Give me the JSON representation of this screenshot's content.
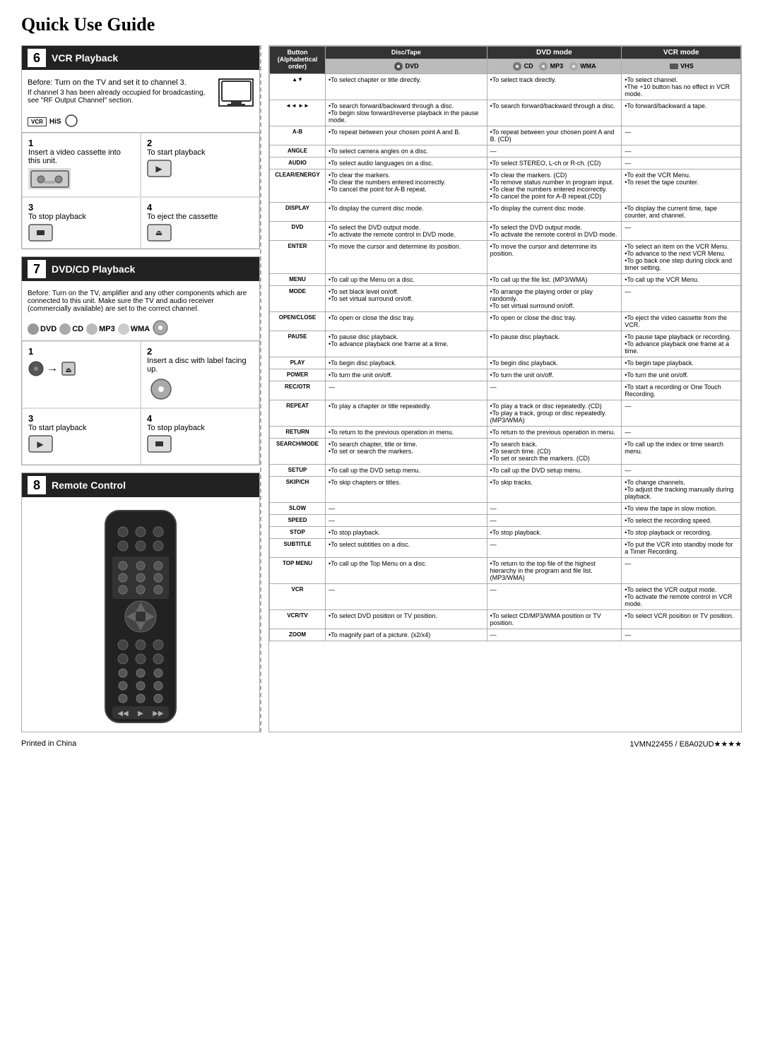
{
  "page": {
    "title": "Quick Use Guide",
    "footer_left": "Printed in China",
    "footer_right": "1VMN22455 / E8A02UD★★★★"
  },
  "section6": {
    "number": "6",
    "title": "VCR Playback",
    "before_text": "Before: Turn on the TV and set it to channel 3.",
    "bullet": "If channel 3 has been already occupied for broadcasting, see \"RF Output Channel\" section.",
    "steps": [
      {
        "num": "1",
        "text": "Insert a video cassette into this unit."
      },
      {
        "num": "2",
        "text": "To start playback"
      },
      {
        "num": "3",
        "text": "To stop playback"
      },
      {
        "num": "4",
        "text": "To eject the cassette"
      }
    ]
  },
  "section7": {
    "number": "7",
    "title": "DVD/CD Playback",
    "before_text": "Before: Turn on the TV, amplifier and any other components which are connected to this unit. Make sure the TV and audio receiver (commercially available) are set to the correct channel.",
    "steps": [
      {
        "num": "1",
        "label": ""
      },
      {
        "num": "2",
        "label": "Insert a disc with label facing up."
      },
      {
        "num": "3",
        "label": "To start playback"
      },
      {
        "num": "4",
        "label": "To stop playback"
      }
    ]
  },
  "section8": {
    "number": "8",
    "title": "Remote Control"
  },
  "table": {
    "headers": {
      "button_col": "Button\n(Alphabetical order)",
      "disc_tape": "Disc/Tape",
      "dvd_mode": "DVD mode",
      "vcr_mode": "VCR mode"
    },
    "sub_headers": {
      "dvd": "DVD",
      "cd_mp3_wma": "CD  MP3  WMA"
    },
    "rows": [
      {
        "button": "▲▼",
        "dvd": "•To select chapter or title directly.",
        "cd": "•To select track directly.",
        "vcr": "•To select channel.\n•The +10 button has no effect in VCR mode."
      },
      {
        "button": "◄◄  ►►",
        "dvd": "•To search forward/backward through a disc.\n•To begin slow forward/reverse playback in the pause mode.",
        "cd": "•To search forward/backward through a disc.",
        "vcr": "•To forward/backward a tape."
      },
      {
        "button": "A-B",
        "dvd": "•To repeat between your chosen point A and B.",
        "cd": "•To repeat between your chosen point A and B. (CD)",
        "vcr": "—"
      },
      {
        "button": "ANGLE",
        "dvd": "•To select camera angles on a disc.",
        "cd": "—",
        "vcr": "—"
      },
      {
        "button": "AUDIO",
        "dvd": "•To select audio languages on a disc.",
        "cd": "•To select STEREO, L-ch or R-ch. (CD)",
        "vcr": "—"
      },
      {
        "button": "CLEAR/ENERGY",
        "dvd": "•To clear the markers.\n•To clear the numbers entered incorrectly.\n•To cancel the point for A-B repeat.",
        "cd": "•To clear the markers. (CD)\n•To remove status number in program input.\n•To clear the numbers entered incorrectly.\n•To cancel the point for A-B repeat.(CD)",
        "vcr": "•To exit the VCR Menu.\n•To reset the tape counter."
      },
      {
        "button": "DISPLAY",
        "dvd": "•To display the current disc mode.",
        "cd": "•To display the current disc mode.",
        "vcr": "•To display the current time, tape counter, and channel."
      },
      {
        "button": "DVD",
        "dvd": "•To select the DVD output mode.\n•To activate the remote control in DVD mode.",
        "cd": "•To select the DVD output mode.\n•To activate the remote control in DVD mode.",
        "vcr": "—"
      },
      {
        "button": "ENTER",
        "dvd": "•To move the cursor and determine its position.",
        "cd": "•To move the cursor and determine its position.",
        "vcr": "•To select an item on the VCR Menu.\n•To advance to the next VCR Menu.\n•To go back one step during clock and timer setting."
      },
      {
        "button": "MENU",
        "dvd": "•To call up the Menu on a disc.",
        "cd": "•To call up the file list. (MP3/WMA)",
        "vcr": "•To call up the VCR Menu."
      },
      {
        "button": "MODE",
        "dvd": "•To set black level on/off.\n•To set virtual surround on/off.",
        "cd": "•To arrange the playing order or play randomly.\n•To set virtual surround on/off.",
        "vcr": "—"
      },
      {
        "button": "OPEN/CLOSE",
        "dvd": "•To open or close the disc tray.",
        "cd": "•To open or close the disc tray.",
        "vcr": "•To eject the video cassette from the VCR."
      },
      {
        "button": "PAUSE",
        "dvd": "•To pause disc playback.\n•To advance playback one frame at a time.",
        "cd": "•To pause disc playback.",
        "vcr": "•To pause tape playback or recording.\n•To advance playback one frame at a time."
      },
      {
        "button": "PLAY",
        "dvd": "•To begin disc playback.",
        "cd": "•To begin disc playback.",
        "vcr": "•To begin tape playback."
      },
      {
        "button": "POWER",
        "dvd": "•To turn the unit on/off.",
        "cd": "•To turn the unit on/off.",
        "vcr": "•To turn the unit on/off."
      },
      {
        "button": "REC/OTR",
        "dvd": "—",
        "cd": "—",
        "vcr": "•To start a recording or One Touch Recording."
      },
      {
        "button": "REPEAT",
        "dvd": "•To play a chapter or title repeatedly.",
        "cd": "•To play a track or disc repeatedly. (CD)\n•To play a track, group or disc repeatedly. (MP3/WMA)",
        "vcr": "—"
      },
      {
        "button": "RETURN",
        "dvd": "•To return to the previous operation in menu.",
        "cd": "•To return to the previous operation in menu.",
        "vcr": "—"
      },
      {
        "button": "SEARCH/MODE",
        "dvd": "•To search chapter, title or time.\n•To set or search the markers.",
        "cd": "•To search track.\n•To search time. (CD)\n•To set or search the markers. (CD)",
        "vcr": "•To call up the index or time search menu."
      },
      {
        "button": "SETUP",
        "dvd": "•To call up the DVD setup menu.",
        "cd": "•To call up the DVD setup menu.",
        "vcr": "—"
      },
      {
        "button": "SKIP/CH",
        "dvd": "•To skip chapters or titles.",
        "cd": "•To skip tracks.",
        "vcr": "•To change channels.\n•To adjust the tracking manually during playback."
      },
      {
        "button": "SLOW",
        "dvd": "—",
        "cd": "—",
        "vcr": "•To view the tape in slow motion."
      },
      {
        "button": "SPEED",
        "dvd": "—",
        "cd": "—",
        "vcr": "•To select the recording speed."
      },
      {
        "button": "STOP",
        "dvd": "•To stop playback.",
        "cd": "•To stop playback.",
        "vcr": "•To stop playback or recording."
      },
      {
        "button": "SUBTITLE",
        "dvd": "•To select subtitles on a disc.",
        "cd": "—",
        "vcr": "•To put the VCR into standby mode for a Timer Recording."
      },
      {
        "button": "TOP MENU",
        "dvd": "•To call up the Top Menu on a disc.",
        "cd": "•To return to the top file of the highest hierarchy in the program and file list. (MP3/WMA)",
        "vcr": "—"
      },
      {
        "button": "VCR",
        "dvd": "—",
        "cd": "—",
        "vcr": "•To select the VCR output mode.\n•To activate the remote control in VCR mode."
      },
      {
        "button": "VCR/TV",
        "dvd": "•To select DVD position or TV position.",
        "cd": "•To select CD/MP3/WMA position or TV position.",
        "vcr": "•To select VCR position or TV position."
      },
      {
        "button": "ZOOM",
        "dvd": "•To magnify part of a picture. (x2/x4)",
        "cd": "—",
        "vcr": "—"
      }
    ]
  }
}
